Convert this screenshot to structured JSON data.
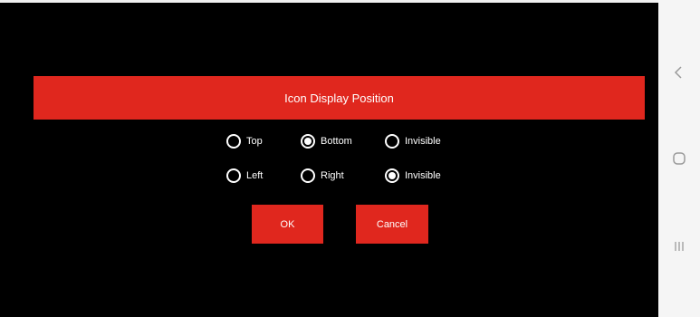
{
  "dialog": {
    "title": "Icon Display Position",
    "row1": [
      {
        "label": "Top",
        "checked": false
      },
      {
        "label": "Bottom",
        "checked": true
      },
      {
        "label": "Invisible",
        "checked": false
      }
    ],
    "row2": [
      {
        "label": "Left",
        "checked": false
      },
      {
        "label": "Right",
        "checked": false
      },
      {
        "label": "Invisible",
        "checked": true
      }
    ],
    "ok_label": "OK",
    "cancel_label": "Cancel"
  },
  "nav": {
    "icons": [
      "back-chevron-icon",
      "home-circle-icon",
      "recents-lines-icon"
    ]
  },
  "colors": {
    "accent": "#e0271e",
    "background": "#000000",
    "navbar": "#f5f5f5",
    "text": "#ffffff"
  }
}
